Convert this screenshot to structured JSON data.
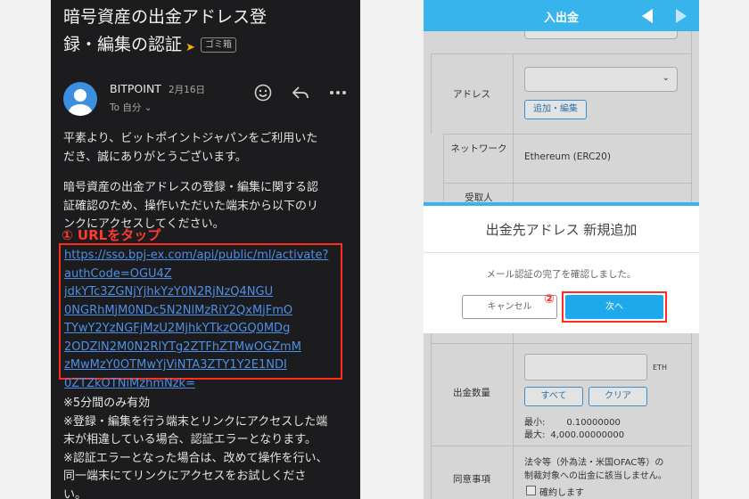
{
  "email": {
    "subject_line1": "暗号資産の出金アドレス登",
    "subject_line2": "録・編集の認証",
    "trash_tag": "ゴミ箱",
    "sender": "BITPOINT",
    "date": "2月16日",
    "to": "To 自分 ⌄",
    "icons": [
      "smiley-icon",
      "reply-icon",
      "more-icon"
    ],
    "greeting": [
      "平素より、ビットポイントジャパンをご利用いた",
      "だき、誠にありがとうございます。"
    ],
    "instruction": [
      "暗号資産の出金アドレスの登録・編集に関する認",
      "証確認のため、操作いただいた端末から以下のリ",
      "ンクにアクセスしてください。"
    ],
    "step1_label": "① URLをタップ",
    "link_lines": [
      "https://sso.bpj-ex.com/api/public/ml/activate?",
      "authCode=OGU4Z",
      "jdkYTc3ZGNjYjhkYzY0N2RjNzQ4NGU",
      "0NGRhMjM0NDc5N2NlMzRiY2QxMjFmO",
      "TYwY2YzNGFjMzU2MjhkYTkzOGQ0MDg",
      "2ODZlN2M0N2RlYTg2ZTFhZTMwOGZmM",
      "zMwMzY0OTMwYjViNTA3ZTY1Y2E1NDI",
      "0ZTZkOTNiMzhmNzk="
    ],
    "notes": [
      "※5分間のみ有効",
      "※登録・編集を行う端末とリンクにアクセスした端",
      "末が相違している場合、認証エラーとなります。",
      "※認証エラーとなった場合は、改めて操作を行い、",
      "同一端末にてリンクにアクセスをお試しくださ",
      "い。"
    ]
  },
  "app": {
    "title": "入出金",
    "address_label": "アドレス",
    "add_edit_button": "追加・編集",
    "network_label": "ネットワーク",
    "network_value": "Ethereum (ERC20)",
    "recipient_label": "受取人",
    "amount_label": "出金数量",
    "unit": "ETH",
    "all_button": "すべて",
    "clear_button": "クリア",
    "min_label": "最小:",
    "min_value": "0.10000000",
    "max_label": "最大:",
    "max_value": "4,000.00000000",
    "consent_label": "同意事項",
    "consent_text": [
      "法令等（外為法・米国OFAC等）の",
      "制裁対象への出金に該当しません。"
    ],
    "confirm_label": "確約します",
    "modal": {
      "title": "出金先アドレス 新規追加",
      "message": "メール認証の完了を確認しました。",
      "cancel": "キャンセル",
      "next": "次へ",
      "step2_label": "②"
    },
    "colors": {
      "accent": "#38b4ec",
      "highlight": "#ff2d20"
    }
  }
}
